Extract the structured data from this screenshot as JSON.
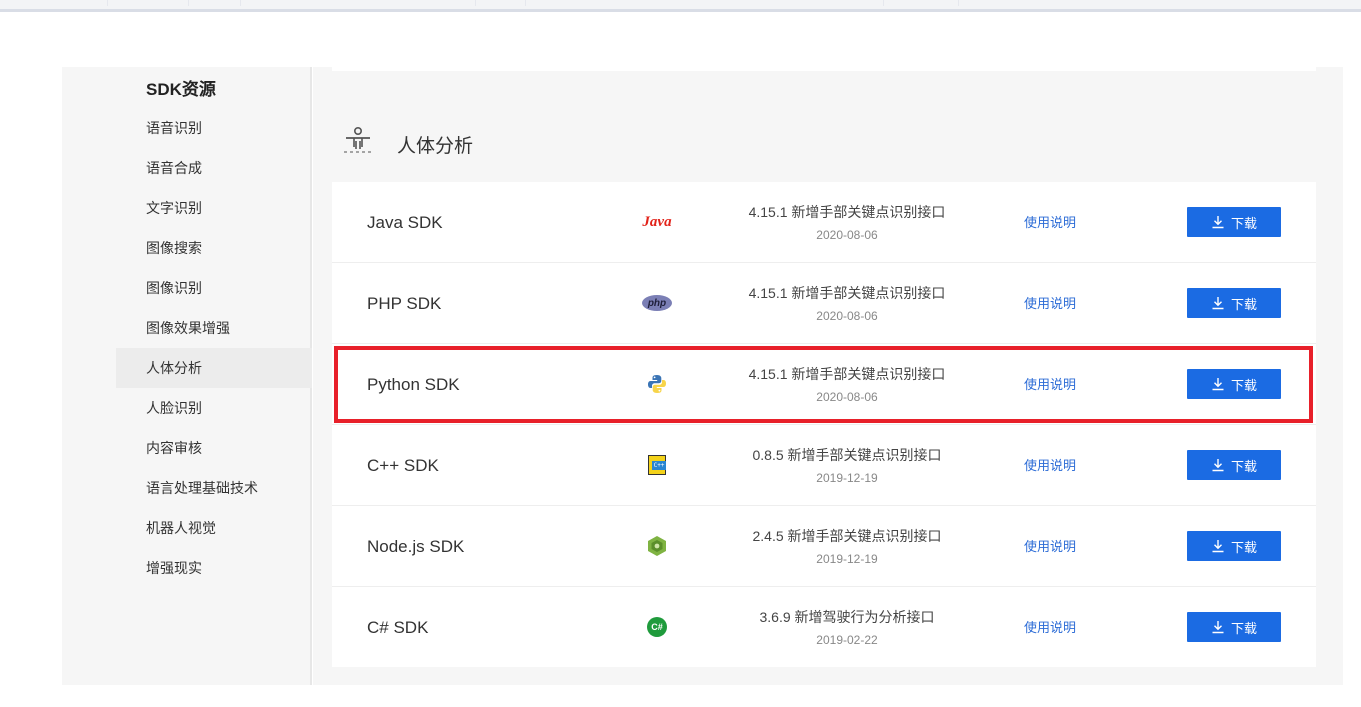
{
  "sidebar": {
    "title": "SDK资源",
    "items": [
      {
        "label": "语音识别"
      },
      {
        "label": "语音合成"
      },
      {
        "label": "文字识别"
      },
      {
        "label": "图像搜索"
      },
      {
        "label": "图像识别"
      },
      {
        "label": "图像效果增强"
      },
      {
        "label": "人体分析",
        "active": true
      },
      {
        "label": "人脸识别"
      },
      {
        "label": "内容审核"
      },
      {
        "label": "语言处理基础技术"
      },
      {
        "label": "机器人视觉"
      },
      {
        "label": "增强现实"
      }
    ]
  },
  "section": {
    "title": "人体分析",
    "icon": "body-analysis-icon"
  },
  "sdks": [
    {
      "name": "Java SDK",
      "logo": "java-logo",
      "version_note": "4.15.1 新增手部关键点识别接口",
      "date": "2020-08-06",
      "doc_label": "使用说明",
      "download_label": "下载",
      "highlighted": false
    },
    {
      "name": "PHP SDK",
      "logo": "php-logo",
      "version_note": "4.15.1 新增手部关键点识别接口",
      "date": "2020-08-06",
      "doc_label": "使用说明",
      "download_label": "下载",
      "highlighted": false
    },
    {
      "name": "Python SDK",
      "logo": "python-logo",
      "version_note": "4.15.1 新增手部关键点识别接口",
      "date": "2020-08-06",
      "doc_label": "使用说明",
      "download_label": "下载",
      "highlighted": true
    },
    {
      "name": "C++ SDK",
      "logo": "cpp-logo",
      "version_note": "0.8.5 新增手部关键点识别接口",
      "date": "2019-12-19",
      "doc_label": "使用说明",
      "download_label": "下载",
      "highlighted": false
    },
    {
      "name": "Node.js SDK",
      "logo": "nodejs-logo",
      "version_note": "2.4.5 新增手部关键点识别接口",
      "date": "2019-12-19",
      "doc_label": "使用说明",
      "download_label": "下载",
      "highlighted": false
    },
    {
      "name": "C# SDK",
      "logo": "csharp-logo",
      "version_note": "3.6.9 新增驾驶行为分析接口",
      "date": "2019-02-22",
      "doc_label": "使用说明",
      "download_label": "下载",
      "highlighted": false
    }
  ],
  "logo_texts": {
    "java": "Java",
    "php": "php",
    "cpp": "C++",
    "csharp": "C#"
  },
  "colors": {
    "accent": "#1b6be3",
    "link": "#2b6bd6",
    "highlight_border": "#e8202a"
  }
}
